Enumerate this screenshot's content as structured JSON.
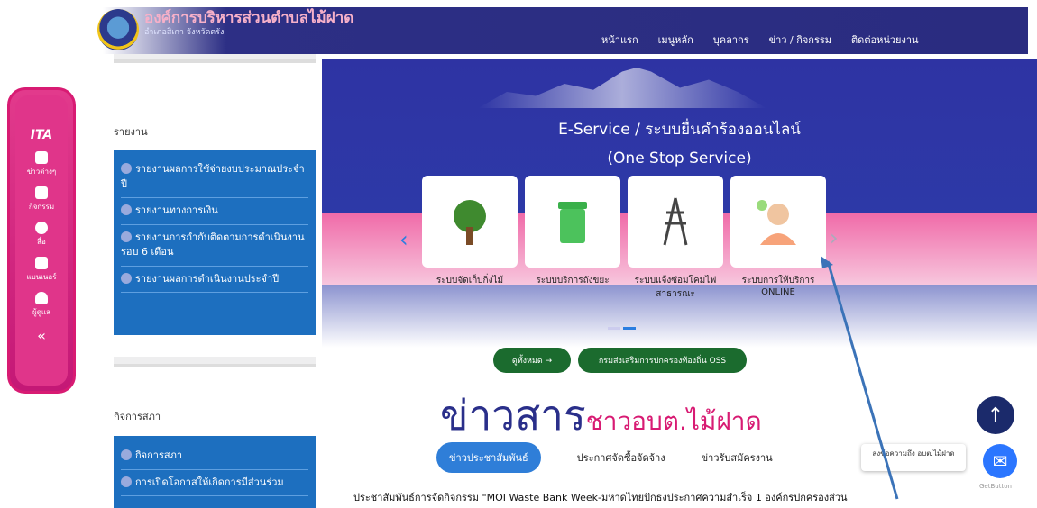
{
  "brand": {
    "title": "องค์การบริหารส่วนตำบลไม้ฝาด",
    "subtitle": "อำเภอสิเกา จังหวัดตรัง"
  },
  "nav": [
    "หน้าแรก",
    "เมนูหลัก",
    "บุคลากร",
    "ข่าว / กิจกรรม",
    "ติดต่อหน่วยงาน"
  ],
  "toolbar": {
    "title": "ITA",
    "items": [
      "ข่าวต่างๆ",
      "กิจกรรม",
      "สื่อ",
      "แบนเนอร์",
      "ผู้ดูแล"
    ],
    "collapse": "«"
  },
  "report": {
    "title": "รายงาน",
    "items": [
      "รายงานผลการใช้จ่ายงบประมาณประจำปี",
      "รายงานทางการเงิน",
      "รายงานการกำกับติดตามการดำเนินงานรอบ 6 เดือน",
      "รายงานผลการดำเนินงานประจำปี"
    ]
  },
  "council": {
    "title": "กิจการสภา",
    "items": [
      "กิจการสภา",
      "การเปิดโอกาสให้เกิดการมีส่วนร่วม"
    ]
  },
  "banner": {
    "title": "E-Service / ระบบยื่นคำร้องออนไลน์",
    "subtitle": "(One Stop Service)"
  },
  "cards": [
    {
      "label": "ระบบจัดเก็บกิ่งไม้",
      "icon": "tree-icon"
    },
    {
      "label": "ระบบบริการถังขยะ",
      "icon": "trash-bin-icon"
    },
    {
      "label": "ระบบแจ้งซ่อมโคมไฟสาธารณะ",
      "icon": "power-tower-icon"
    },
    {
      "label": "ระบบการให้บริการ ONLINE",
      "icon": "operator-icon"
    }
  ],
  "buttons": {
    "view_all": "ดูทั้งหมด →",
    "oss": "กรมส่งเสริมการปกครองท้องถิ่น OSS"
  },
  "news": {
    "title": "ข่าวสาร",
    "sub": "ชาวอบต.ไม้ฝาด"
  },
  "tabs": [
    "ข่าวประชาสัมพันธ์",
    "ประกาศจัดซื้อจัดจ้าง",
    "ข่าวรับสมัครงาน"
  ],
  "ticker": "ประชาสัมพันธ์การจัดกิจกรรม \"MOI Waste Bank Week-มหาดไทยปักธงประกาศความสำเร็จ 1 องค์กรปกครองส่วน",
  "chat": {
    "message": "ส่งข้อความถึง อบต.ไม้ฝาด",
    "credit": "GetButton"
  }
}
